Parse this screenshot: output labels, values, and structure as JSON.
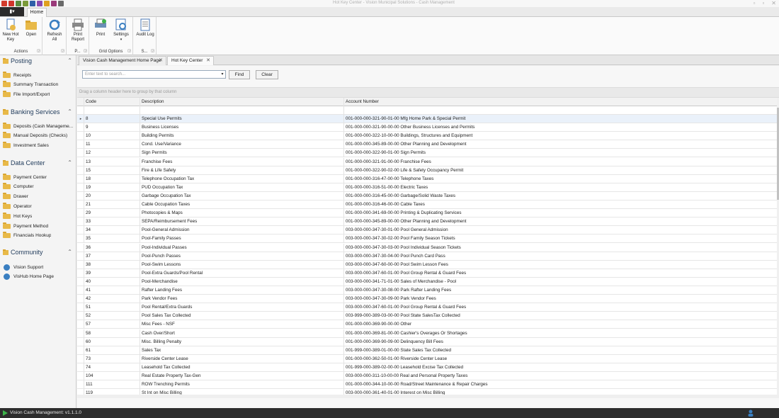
{
  "title_bar": {
    "text": "Hot Key Center - Vision Municipal Solutions - Cash Management",
    "qat_colors": [
      "#d23a2a",
      "#d0342c",
      "#5a8a3c",
      "#7a9a3a",
      "#2e5fa8",
      "#8a4ab0",
      "#e0a020",
      "#9a3a7a",
      "#6a6a6a"
    ]
  },
  "ribbon_tabs": {
    "app_menu": "▮▾",
    "home": "Home"
  },
  "ribbon": {
    "groups": [
      {
        "label": "Actions",
        "buttons": [
          "New Hot Key",
          "Open"
        ]
      },
      {
        "label": "",
        "buttons": [
          "Refresh All"
        ]
      },
      {
        "label": "P...",
        "buttons": [
          "Print Report"
        ]
      },
      {
        "label": "Grid Options",
        "buttons": [
          "Print",
          "Settings"
        ]
      },
      {
        "label": "S...",
        "buttons": [
          "Audit Log"
        ]
      }
    ]
  },
  "sidebar": {
    "sections": [
      {
        "title": "Posting",
        "items": [
          "Receipts",
          "Summary Transaction",
          "File Import/Export"
        ]
      },
      {
        "title": "Banking Services",
        "items": [
          "Deposits (Cash Manageme...",
          "Manual Deposits (Checks)",
          "Investment Sales"
        ]
      },
      {
        "title": "Data Center",
        "items": [
          "Payment Center",
          "Computer",
          "Drawer",
          "Operator",
          "Hot Keys",
          "Payment Method",
          "Financials Hookup"
        ]
      },
      {
        "title": "Community",
        "items": [
          "Vision Support",
          "VisHub Home Page"
        ]
      }
    ]
  },
  "doc_tabs": [
    "Vision Cash Management Home Page",
    "Hot Key Center"
  ],
  "search": {
    "placeholder": "Enter text to search...",
    "find_label": "Find",
    "clear_label": "Clear"
  },
  "group_panel_text": "Drag a column header here to group by that column",
  "grid": {
    "columns": [
      "Code",
      "Description",
      "Account Number"
    ],
    "rows": [
      [
        "8",
        "Special Use Permits",
        "001-000-000-321-90-01-00  Mfg Home Park & Special Permit"
      ],
      [
        "9",
        "Business Licenses",
        "001-000-000-321-90-00-00  Other Business Licenses and Permits"
      ],
      [
        "10",
        "Building Permits",
        "001-000-000-322-10-00-00  Buildings, Structures and Equipment"
      ],
      [
        "11",
        "Cond. Use/Variance",
        "001-000-000-345-89-00-00  Other Planning and Development"
      ],
      [
        "12",
        "Sign Permits",
        "001-000-000-322-90-01-00  Sign Permits"
      ],
      [
        "13",
        "Franchise Fees",
        "001-000-000-321-91-00-00  Franchise Fees"
      ],
      [
        "15",
        "Fire & Life Safety",
        "001-000-000-322-90-02-00  Life & Safety Occupancy Permit"
      ],
      [
        "18",
        "Telephone Occupation Tax",
        "001-000-000-316-47-00-00  Telephone Taxes"
      ],
      [
        "19",
        "PUD Occupation Tax",
        "001-000-000-316-51-00-00  Electric Taxes"
      ],
      [
        "20",
        "Garbage Occupation Tax",
        "001-000-000-316-45-00-00  Garbage/Solid Waste Taxes"
      ],
      [
        "21",
        "Cable Occupation Taxes",
        "001-000-000-316-46-00-00  Cable Taxes"
      ],
      [
        "29",
        "Photocopies & Maps",
        "001-000-000-341-69-00-00  Printing & Duplicating Services"
      ],
      [
        "33",
        "SEPA/Reimbursement Fees",
        "001-000-000-345-89-00-00  Other Planning and Development"
      ],
      [
        "34",
        "Pool-General Admission",
        "003-000-000-347-30-01-00  Pool General Admission"
      ],
      [
        "35",
        "Pool-Family Passes",
        "003-000-000-347-30-02-00  Pool Family Season Tickets"
      ],
      [
        "36",
        "Pool-Individual Passes",
        "003-000-000-347-30-03-00  Pool Individual Season Tickets"
      ],
      [
        "37",
        "Pool-Punch Passes",
        "003-000-000-347-30-04-00  Pool Punch Card Pass"
      ],
      [
        "38",
        "Pool-Swim Lessons",
        "003-000-000-347-60-00-00  Pool Swim Lesson Fees"
      ],
      [
        "39",
        "Pool-Extra Guards/Pool Rental",
        "003-000-000-347-60-01-00  Pool Group Rental & Guard Fees"
      ],
      [
        "40",
        "Pool-Merchandise",
        "003-000-000-341-71-01-00  Sales of Merchandise - Pool"
      ],
      [
        "41",
        "Rafter Landing Fees",
        "003-000-000-347-30-08-00  Park Rafter Landing Fees"
      ],
      [
        "42",
        "Park Vendor Fees",
        "003-000-000-347-30-09-00  Park Vendor Fees"
      ],
      [
        "51",
        "Pool Rental/Extra Guards",
        "003-000-000-347-60-01-00  Pool Group Rental & Guard Fees"
      ],
      [
        "52",
        "Pool Sales Tax Collected",
        "003-999-000-389-03-00-00  Pool State SalesTax Collected"
      ],
      [
        "57",
        "Misc Fees - NSF",
        "001-000-000-369-90-00-00  Other"
      ],
      [
        "58",
        "Cash Over/Short",
        "001-000-000-369-81-00-00  Cashier's Overages Or Shortages"
      ],
      [
        "60",
        "Misc. Billing Penalty",
        "001-000-000-369-90-09-00  Delinquency Bill Fees"
      ],
      [
        "61",
        "Sales Tax",
        "001-999-000-389-01-00-00  State Sales Tax Collected"
      ],
      [
        "73",
        "Riverside Center Lease",
        "001-000-000-362-50-01-00  Riverside Center Lease"
      ],
      [
        "74",
        "Leasehold Tax Collected",
        "001-999-000-389-02-00-00  Leasehold Excise Tax Collected"
      ],
      [
        "104",
        "Real Estate Property Tax-Gen",
        "003-000-000-311-10-00-00  Real and Personal Property Taxes"
      ],
      [
        "111",
        "ROW Trenching Permits",
        "001-000-000-344-10-00-00  Road/Street Maintenance & Repair Charges"
      ],
      [
        "119",
        "St Int on Misc Billing",
        "003-000-000-361-40-01-00  Interest on Misc Billing"
      ]
    ]
  },
  "status_bar": {
    "text": "Vision Cash Management: v1.1.1.0"
  }
}
